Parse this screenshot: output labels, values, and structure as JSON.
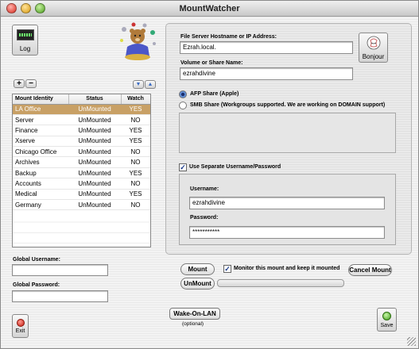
{
  "window": {
    "title": "MountWatcher"
  },
  "log_button": {
    "label": "Log"
  },
  "list_controls": {
    "add": "+",
    "remove": "−",
    "move_down": "▼",
    "move_up": "▲"
  },
  "mount_table": {
    "columns": [
      "Mount Identity",
      "Status",
      "Watch"
    ],
    "rows": [
      {
        "identity": "LA Office",
        "status": "UnMounted",
        "watch": "YES"
      },
      {
        "identity": "Server",
        "status": "UnMounted",
        "watch": "NO"
      },
      {
        "identity": "Finance",
        "status": "UnMounted",
        "watch": "YES"
      },
      {
        "identity": "Xserve",
        "status": "UnMounted",
        "watch": "YES"
      },
      {
        "identity": "Chicago Office",
        "status": "UnMounted",
        "watch": "NO"
      },
      {
        "identity": "Archives",
        "status": "UnMounted",
        "watch": "NO"
      },
      {
        "identity": "Backup",
        "status": "UnMounted",
        "watch": "YES"
      },
      {
        "identity": "Accounts",
        "status": "UnMounted",
        "watch": "NO"
      },
      {
        "identity": "Medical",
        "status": "UnMounted",
        "watch": "YES"
      },
      {
        "identity": "Germany",
        "status": "UnMounted",
        "watch": "NO"
      }
    ],
    "selected_row": 0
  },
  "global": {
    "username_label": "Global Username:",
    "username_value": "",
    "password_label": "Global Password:",
    "password_value": ""
  },
  "exit_button": {
    "label": "Exit"
  },
  "server": {
    "hostname_label": "File Server Hostname or IP Address:",
    "hostname_value": "Ezrah.local.",
    "volume_label": "Volume or Share Name:",
    "volume_value": "ezrahdivine",
    "bonjour_label": "Bonjour"
  },
  "share_type": {
    "afp_label": "AFP Share (Apple)",
    "smb_label": "SMB Share (Workgroups supported.  We are working on DOMAIN support)",
    "selected": "afp"
  },
  "credentials": {
    "separate_label": "Use Separate Username/Password",
    "separate_checked": true,
    "username_label": "Username:",
    "username_value": "ezrahdivine",
    "password_label": "Password:",
    "password_value": "***********"
  },
  "actions": {
    "mount_label": "Mount",
    "unmount_label": "UnMount",
    "monitor_label": "Monitor this mount and keep it mounted",
    "monitor_checked": true,
    "cancel_mount_label": "Cancel Mount",
    "wake_label": "Wake-On-LAN",
    "wake_optional": "(optional)",
    "save_label": "Save"
  },
  "colors": {
    "selection": "#c8a065",
    "accent_blue": "#3c6dc4"
  }
}
